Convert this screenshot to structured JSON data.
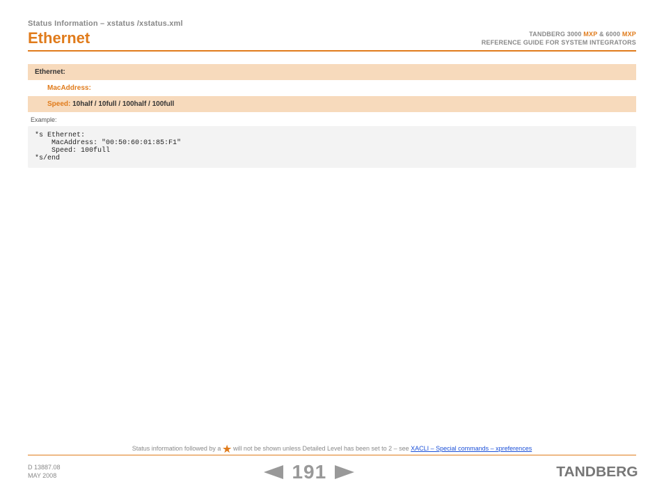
{
  "breadcrumb": "Status Information – xstatus /xstatus.xml",
  "title": "Ethernet",
  "header": {
    "line1_pre": "TANDBERG 3000",
    "line1_mxp1": " MXP",
    "line1_mid": " & 6000",
    "line1_mxp2": " MXP",
    "line2": "REFERENCE GUIDE FOR SYSTEM INTEGRATORS"
  },
  "table": {
    "ethernet_label": "Ethernet:",
    "mac_label": "MacAddress:",
    "speed_label": "Speed: ",
    "speed_values": "10half / 10full / 100half / 100full"
  },
  "example_label": "Example:",
  "code": "*s Ethernet:\n    MacAddress: \"00:50:60:01:85:F1\"\n    Speed: 100full\n*s/end",
  "footnote": {
    "pre": "Status information followed by a ",
    "post": " will not be shown unless Detailed Level has been set to 2 – see ",
    "link": "XACLI – Special commands – xpreferences"
  },
  "doc": {
    "id": "D 13887.08",
    "date": "MAY 2008"
  },
  "page_number": "191",
  "brand": "TANDBERG"
}
